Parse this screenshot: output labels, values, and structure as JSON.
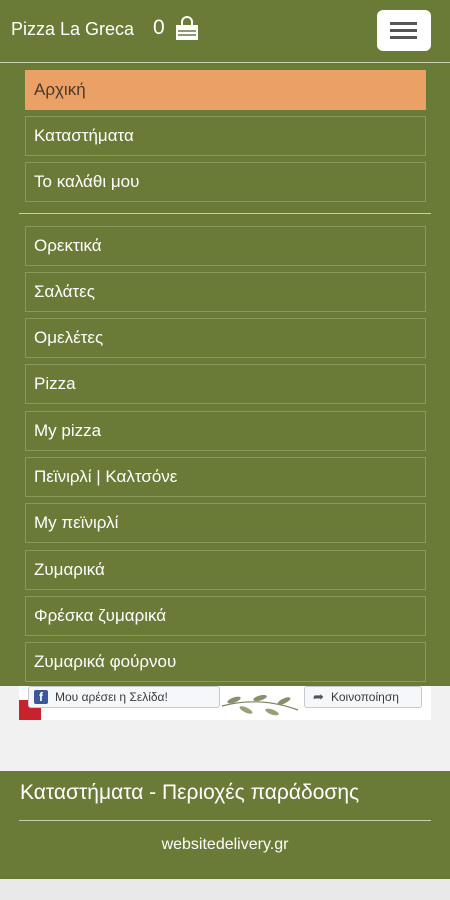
{
  "header": {
    "brand": "Pizza La Greca",
    "cart_count": "0",
    "cart_icon": "shopping-bag-icon",
    "menu_icon": "hamburger-menu-icon"
  },
  "nav": {
    "primary": [
      "Αρχική",
      "Καταστήματα",
      "Το καλάθι μου"
    ],
    "categories": [
      "Ορεκτικά",
      "Σαλάτες",
      "Ομελέτες",
      "Pizza",
      "My pizza",
      "Πεϊνιρλί | Καλτσόνε",
      "My πεϊνιρλί",
      "Ζυμαρικά",
      "Φρέσκα ζυμαρικά",
      "Ζυμαρικά φούρνου"
    ]
  },
  "social": {
    "like_label": "Μου αρέσει η Σελίδα!",
    "share_label": "Κοινοποίηση"
  },
  "footer": {
    "title": "Καταστήματα - Περιοχές παράδοσης",
    "link": "websitedelivery.gr"
  },
  "colors": {
    "brand_green": "#6a7b38",
    "active_orange": "#eba066"
  }
}
